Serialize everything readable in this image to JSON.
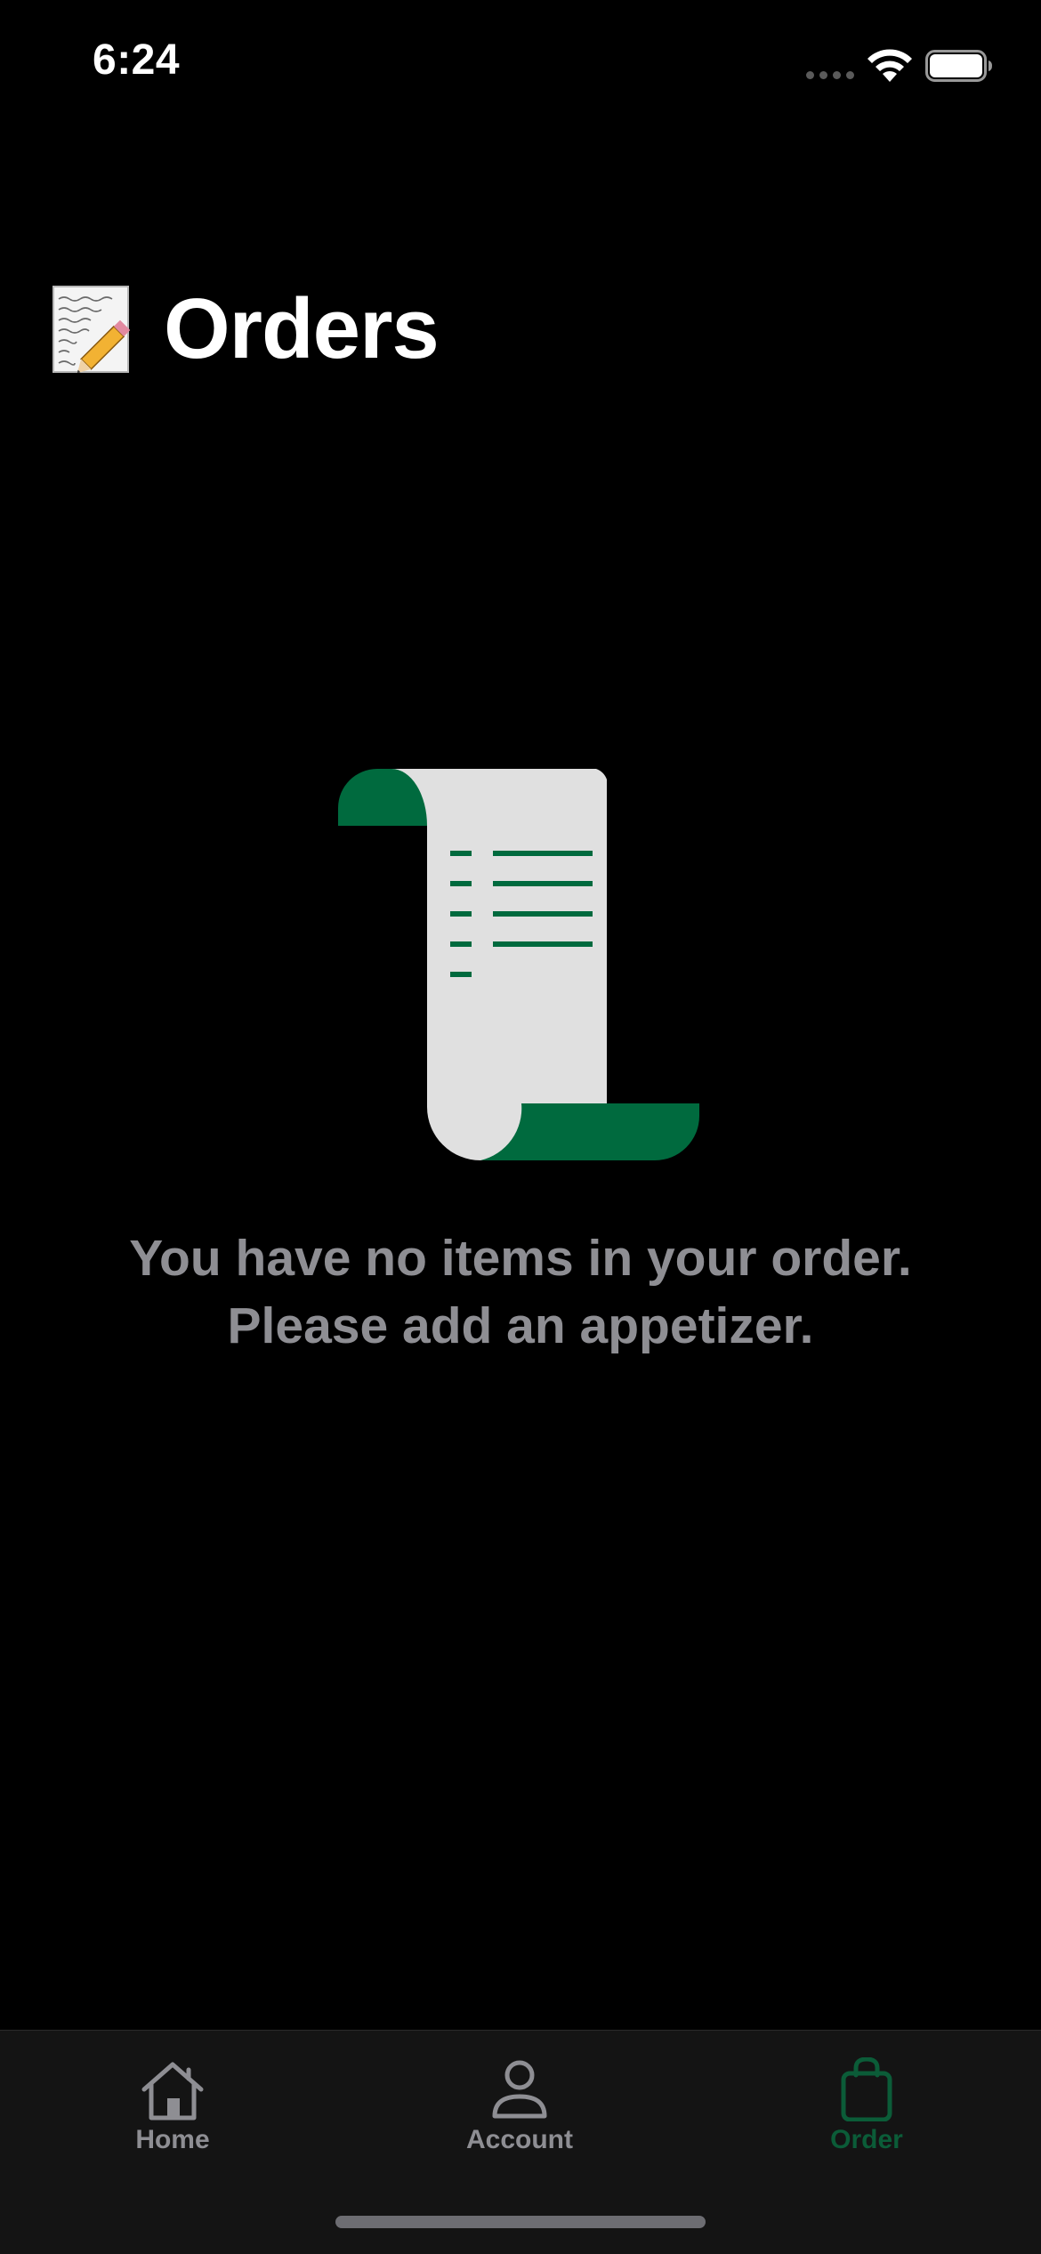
{
  "status_bar": {
    "time": "6:24"
  },
  "header": {
    "emoji_icon": "memo-icon",
    "title": "Orders"
  },
  "empty_state": {
    "illustration": "receipt-scroll-icon",
    "line1": "You have no items in your order.",
    "line2": "Please add an appetizer."
  },
  "tab_bar": {
    "tabs": [
      {
        "label": "Home",
        "icon": "house-icon",
        "selected": false
      },
      {
        "label": "Account",
        "icon": "person-icon",
        "selected": false
      },
      {
        "label": "Order",
        "icon": "bag-icon",
        "selected": true
      }
    ]
  },
  "colors": {
    "background": "#000000",
    "accent": "#0b5c38",
    "illustration_green": "#006a3e",
    "paper": "#e0e0e0",
    "secondary_text": "#8e8e93",
    "tab_bar_bg": "#141414"
  }
}
